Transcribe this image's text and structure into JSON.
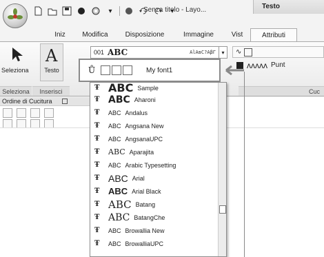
{
  "window": {
    "title": "Senza titolo - Layo...",
    "context_tab": "Testo"
  },
  "tabs": [
    {
      "label": "Iniz"
    },
    {
      "label": "Modifica"
    },
    {
      "label": "Disposizione"
    },
    {
      "label": "Immagine"
    },
    {
      "label": "Vist"
    },
    {
      "label": "Attributi",
      "active": true
    }
  ],
  "ribbon": {
    "select_label": "Seleziona",
    "text_label": "Testo",
    "font_number": "001",
    "font_sample": "ABC",
    "font_preview": "AlАвС?ΑβΓ",
    "stitch_label": "Punt",
    "groups": {
      "select": "Seleziona",
      "insert": "Inserisci",
      "cuc": "Cuc"
    }
  },
  "pane": {
    "title": "Ordine di Cucitura"
  },
  "callout": {
    "icon": "Ů",
    "label": "My font1"
  },
  "font_list": [
    {
      "sample": "ABC",
      "name": "Sample"
    },
    {
      "sample": "ABC",
      "name": "Aharoni"
    },
    {
      "sample": "ABC",
      "name": "Andalus"
    },
    {
      "sample": "ABC",
      "name": "Angsana New"
    },
    {
      "sample": "ABC",
      "name": "AngsanaUPC"
    },
    {
      "sample": "ABC",
      "name": "Aparajita"
    },
    {
      "sample": "ABC",
      "name": "Arabic Typesetting"
    },
    {
      "sample": "ABC",
      "name": "Arial"
    },
    {
      "sample": "ABC",
      "name": "Arial Black"
    },
    {
      "sample": "ABC",
      "name": "Batang"
    },
    {
      "sample": "ABC",
      "name": "BatangChe"
    },
    {
      "sample": "ABC",
      "name": "Browallia New"
    },
    {
      "sample": "ABC",
      "name": "BrowalliaUPC"
    }
  ]
}
